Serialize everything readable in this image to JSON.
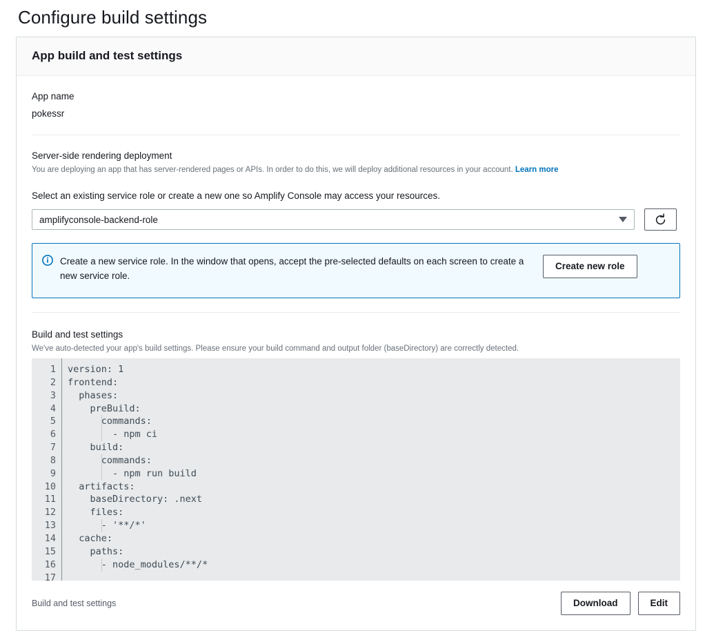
{
  "page": {
    "title": "Configure build settings"
  },
  "card": {
    "header_title": "App build and test settings",
    "app_name_label": "App name",
    "app_name_value": "pokessr",
    "ssr": {
      "heading": "Server-side rendering deployment",
      "description": "You are deploying an app that has server-rendered pages or APIs. In order to do this, we will deploy additional resources in your account.",
      "learn_more": "Learn more",
      "select_label": "Select an existing service role or create a new one so Amplify Console may access your resources.",
      "select_value": "amplifyconsole-backend-role",
      "refresh_icon": "refresh-icon"
    },
    "alert": {
      "icon": "info-circle-icon",
      "text": "Create a new service role. In the window that opens, accept the pre-selected defaults on each screen to create a new service role.",
      "button_label": "Create new role",
      "border_color": "#0073bb",
      "background_color": "#f1faff"
    },
    "build": {
      "heading": "Build and test settings",
      "description": "We've auto-detected your app's build settings. Please ensure your build command and output folder (baseDirectory) are correctly detected.",
      "editor": {
        "line_numbers": [
          "1",
          "2",
          "3",
          "4",
          "5",
          "6",
          "7",
          "8",
          "9",
          "10",
          "11",
          "12",
          "13",
          "14",
          "15",
          "16",
          "17"
        ],
        "lines": [
          "version: 1",
          "frontend:",
          "  phases:",
          "    preBuild:",
          "      commands:",
          "        - npm ci",
          "    build:",
          "      commands:",
          "        - npm run build",
          "  artifacts:",
          "    baseDirectory: .next",
          "    files:",
          "      - '**/*'",
          "  cache:",
          "    paths:",
          "      - node_modules/**/*",
          ""
        ],
        "background_color": "#e8eaeb",
        "text_color": "#3f4b56"
      }
    },
    "footer": {
      "label": "Build and test settings",
      "download_label": "Download",
      "edit_label": "Edit"
    }
  }
}
